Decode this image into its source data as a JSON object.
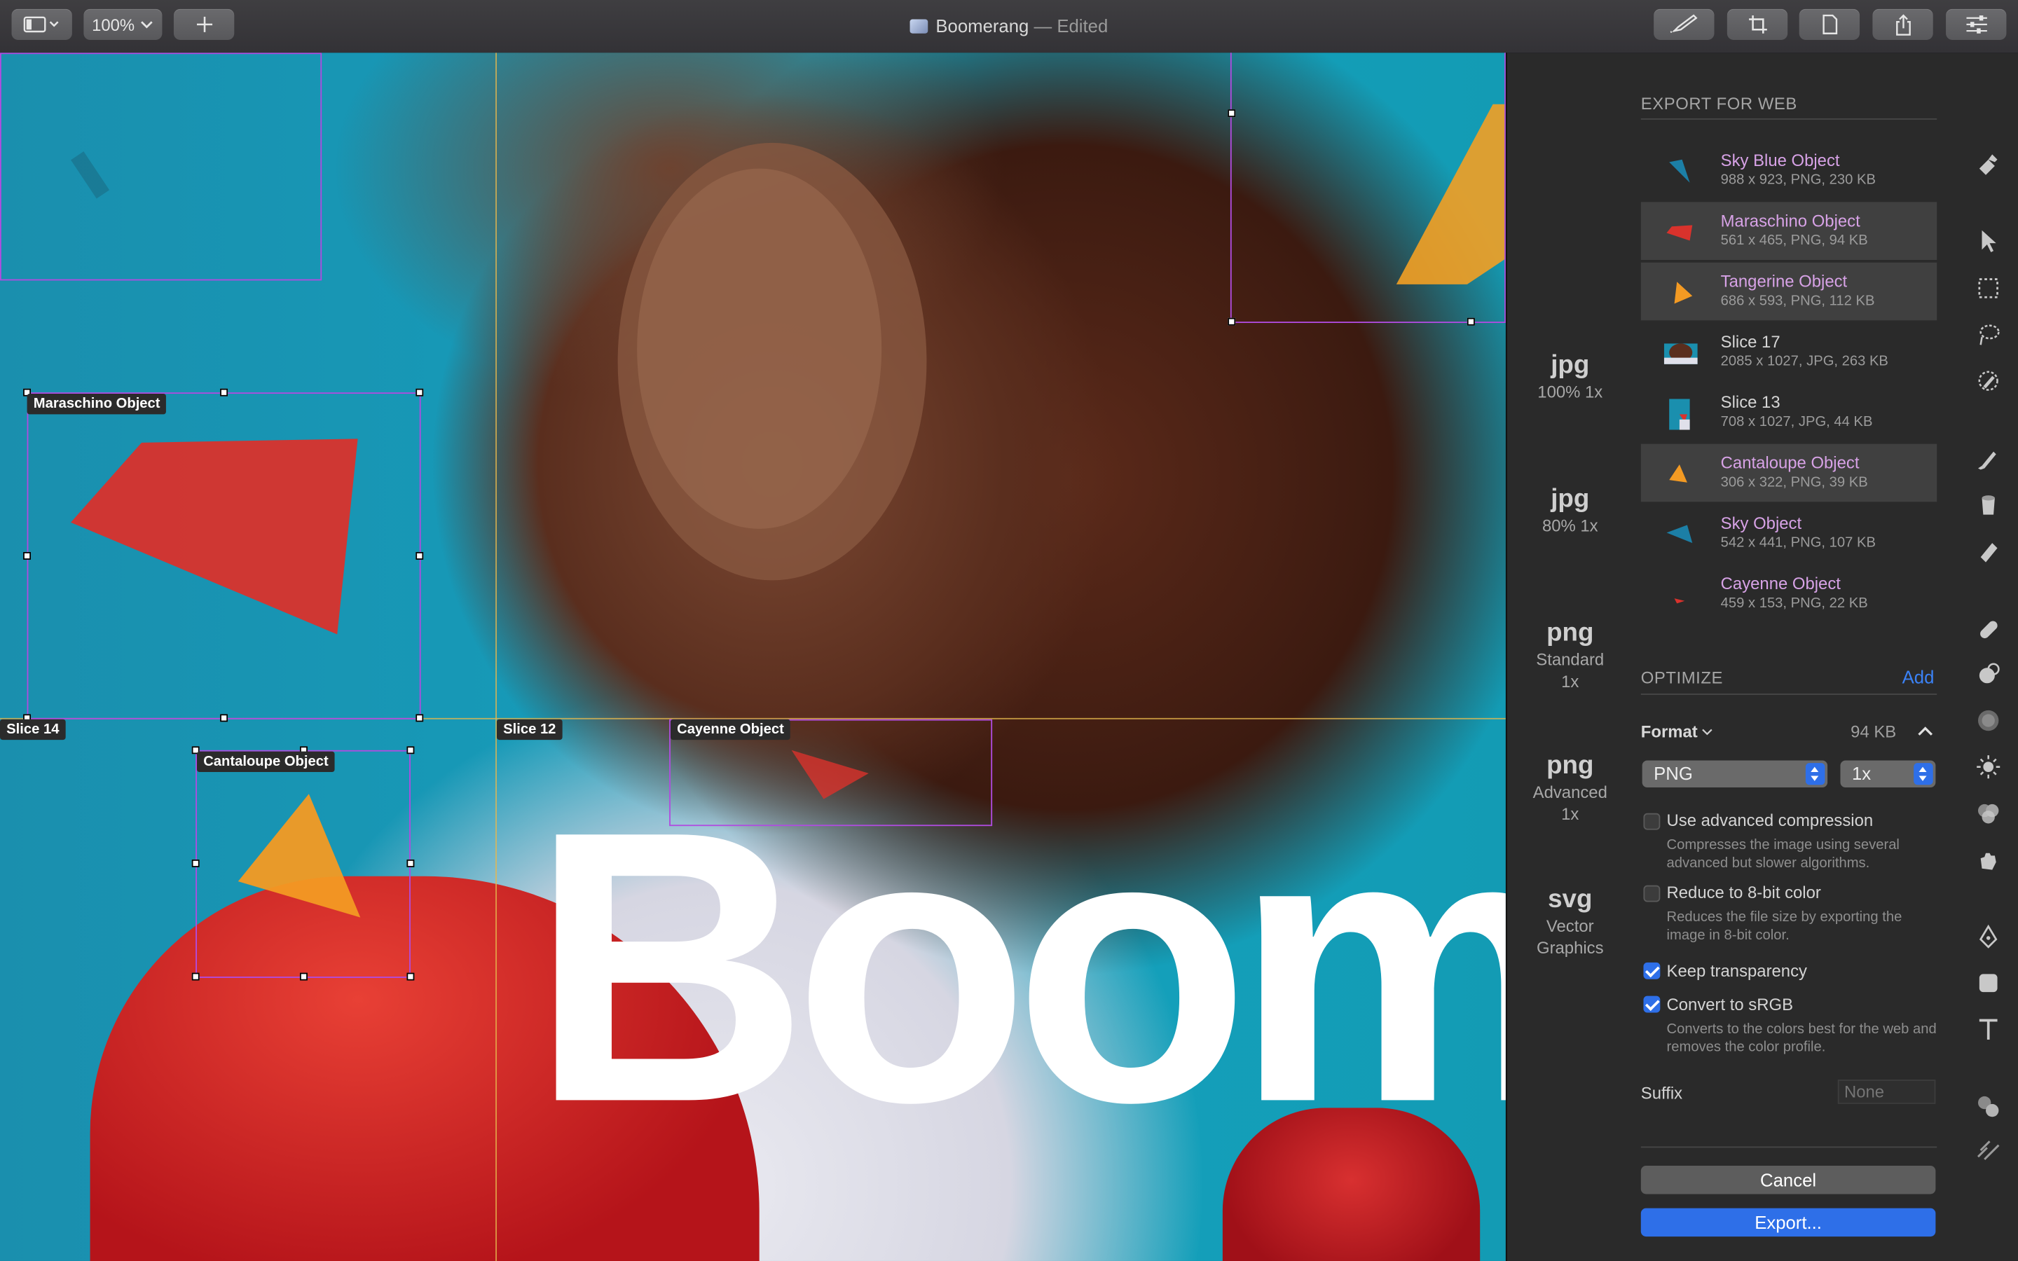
{
  "window": {
    "title": "Boomerang",
    "title_suffix": "— Edited",
    "zoom": "100%"
  },
  "canvas": {
    "headline": "Boom",
    "slice_tags": [
      "Maraschino Object",
      "Slice 14",
      "Slice 12",
      "Cayenne Object",
      "Cantaloupe Object"
    ]
  },
  "formats": [
    {
      "type": "jpg",
      "line1": "100% 1x",
      "line2": ""
    },
    {
      "type": "jpg",
      "line1": "80% 1x",
      "line2": ""
    },
    {
      "type": "png",
      "line1": "Standard",
      "line2": "1x"
    },
    {
      "type": "png",
      "line1": "Advanced",
      "line2": "1x"
    },
    {
      "type": "svg",
      "line1": "Vector",
      "line2": "Graphics"
    }
  ],
  "export_section": {
    "title": "EXPORT FOR WEB",
    "items": [
      {
        "name": "Sky Blue Object",
        "meta": "988 x 923, PNG, 230 KB"
      },
      {
        "name": "Maraschino Object",
        "meta": "561 x 465, PNG, 94 KB"
      },
      {
        "name": "Tangerine Object",
        "meta": "686 x 593, PNG, 112 KB"
      },
      {
        "name": "Slice 17",
        "meta": "2085 x 1027, JPG, 263 KB"
      },
      {
        "name": "Slice 13",
        "meta": "708 x 1027, JPG, 44 KB"
      },
      {
        "name": "Cantaloupe Object",
        "meta": "306 x 322, PNG, 39 KB"
      },
      {
        "name": "Sky Object",
        "meta": "542 x 441, PNG, 107 KB"
      },
      {
        "name": "Cayenne Object",
        "meta": "459 x 153, PNG, 22 KB"
      }
    ]
  },
  "optimize": {
    "title": "OPTIMIZE",
    "add_label": "Add",
    "format_label": "Format",
    "size": "94 KB",
    "format_value": "PNG",
    "scale_value": "1x",
    "options": [
      {
        "label": "Use advanced compression",
        "desc": "Compresses the image using several advanced but slower algorithms.",
        "checked": false
      },
      {
        "label": "Reduce to 8-bit color",
        "desc": "Reduces the file size by exporting the image in 8-bit color.",
        "checked": false
      },
      {
        "label": "Keep transparency",
        "desc": "",
        "checked": true
      },
      {
        "label": "Convert to sRGB",
        "desc": "Converts to the colors best for the web and removes the color profile.",
        "checked": true
      }
    ],
    "suffix_label": "Suffix",
    "suffix_placeholder": "None"
  },
  "buttons": {
    "cancel": "Cancel",
    "export": "Export..."
  },
  "colors": {
    "accent": "#2e6fe8",
    "object_name": "#d7a2e6",
    "slice_border": "#b04ce0",
    "guide": "#e6b84e"
  }
}
